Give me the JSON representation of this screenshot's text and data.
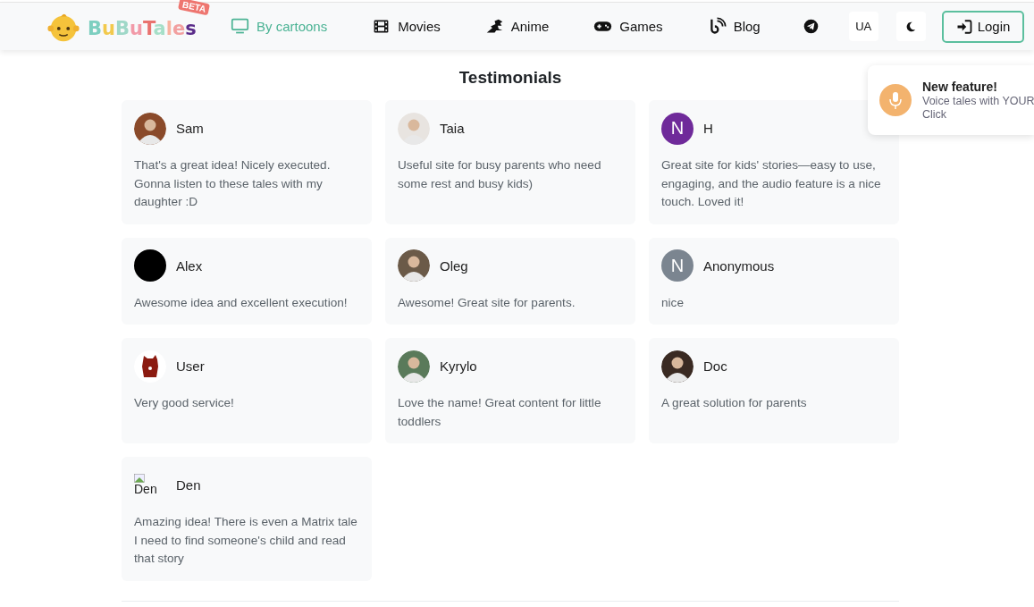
{
  "header": {
    "logo": {
      "text": "BuBuTales",
      "badge": "BETA"
    },
    "nav": [
      {
        "label": "By cartoons",
        "kind": "tv",
        "selected": true
      },
      {
        "label": "Movies",
        "kind": "film",
        "selected": false
      },
      {
        "label": "Anime",
        "kind": "dragon",
        "selected": false
      },
      {
        "label": "Games",
        "kind": "gamepad",
        "selected": false
      },
      {
        "label": "Blog",
        "kind": "blog",
        "selected": false
      }
    ],
    "language": "UA",
    "login": "Login"
  },
  "title": "Testimonials",
  "testimonials": [
    {
      "name": "Sam",
      "avatar": {
        "kind": "photo",
        "color": "#8a4a2a"
      },
      "text": "That's a great idea! Nicely executed. Gonna listen to these tales with my daughter :D"
    },
    {
      "name": "Taia",
      "avatar": {
        "kind": "photo",
        "color": "#e8e4e0"
      },
      "text": "Useful site for busy parents who need some rest and busy kids)"
    },
    {
      "name": "H",
      "avatar": {
        "kind": "letter",
        "letter": "N",
        "color": "#6f2a9a"
      },
      "text": "Great site for kids' stories—easy to use, engaging, and the audio feature is a nice touch. Loved it!"
    },
    {
      "name": "Alex",
      "avatar": {
        "kind": "plain",
        "color": "#000000"
      },
      "text": "Awesome idea and excellent execution!"
    },
    {
      "name": "Oleg",
      "avatar": {
        "kind": "photo",
        "color": "#6b5a48"
      },
      "text": "Awesome! Great site for parents."
    },
    {
      "name": "Anonymous",
      "avatar": {
        "kind": "letter",
        "letter": "N",
        "color": "#7b8590"
      },
      "text": "nice"
    },
    {
      "name": "User",
      "avatar": {
        "kind": "mascot",
        "color": "#8b1a10"
      },
      "text": "Very good service!"
    },
    {
      "name": "Kyrylo",
      "avatar": {
        "kind": "photo",
        "color": "#5a7a5a"
      },
      "text": "Love the name! Great content for little toddlers"
    },
    {
      "name": "Doc",
      "avatar": {
        "kind": "photo",
        "color": "#3a2a22"
      },
      "text": "A great solution for parents"
    },
    {
      "name": "Den",
      "avatar": {
        "kind": "broken",
        "alt": "Den"
      },
      "text": "Amazing idea! There is even a Matrix tale I need to find someone's child and read that story"
    }
  ],
  "toast": {
    "title": "New feature!",
    "lines": [
      "Voice tales with YOUR",
      "Click"
    ]
  }
}
